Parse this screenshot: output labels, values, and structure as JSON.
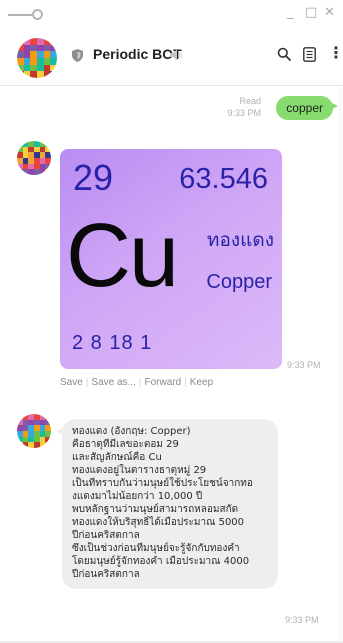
{
  "window": {
    "minimize": "_",
    "maximize": "□",
    "close": "✕"
  },
  "header": {
    "bot_name": "Periodic BOT",
    "icons": [
      "shield-icon",
      "mute-icon",
      "search-icon",
      "notes-icon",
      "more-icon"
    ],
    "more": "⋮"
  },
  "messages": {
    "outgoing": {
      "read_label": "Read",
      "time": "9:33 PM",
      "text": "copper"
    },
    "card": {
      "atomic_number": "29",
      "atomic_mass": "63.546",
      "symbol": "Cu",
      "thai_name": "ทองแดง",
      "english_name": "Copper",
      "electron_shells": "2 8 18 1",
      "time": "9:33 PM",
      "background": "#c79cf5",
      "text_color": "#2a23a8"
    },
    "actions": {
      "save": "Save",
      "save_as": "Save as...",
      "forward": "Forward",
      "keep": "Keep",
      "separator": "|"
    },
    "info": {
      "lines": [
        "ทองแดง (อังกฤษ: Copper)",
        "คือธาตุที่มีเลขอะตอม 29",
        "และสัญลักษณ์คือ Cu",
        "ทองแดงอยู่ในตารางธาตุหมู่ 29",
        "เป็นที่ทราบกันว่ามนุษย์ใช้ประโยชน์จากทอ",
        "งแดงมาไม่น้อยกว่า 10,000 ปี",
        "พบหลักฐานว่ามนุษย์สามารถหลอมสกัด",
        "ทองแดงให้บริสุทธิ์ได้เมื่อประมาณ 5000",
        "ปีก่อนคริสตกาล",
        "ซึ่งเป็นช่วงก่อนที่มนุษย์จะรู้จักกับทองคำ",
        "โดยมนุษย์รู้จักทองคำ เมื่อประมาณ 4000",
        "ปีก่อนคริสตกาล"
      ],
      "time": "9:33 PM"
    }
  },
  "colors": {
    "outgoing_bubble": "#86dc6f",
    "incoming_bubble": "#eeeeee",
    "meta_text": "#b0b0b0"
  }
}
